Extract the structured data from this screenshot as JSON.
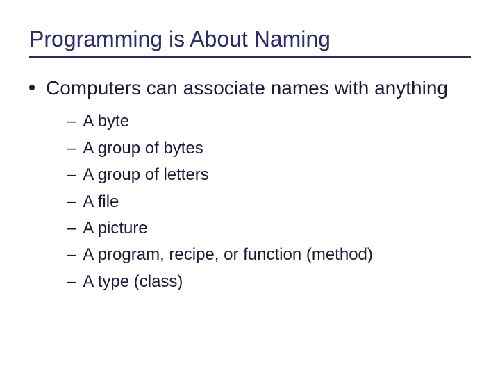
{
  "title": "Programming is About Naming",
  "bullet": {
    "text": "Computers can associate names with anything",
    "subitems": [
      "A byte",
      "A group of bytes",
      "A group of letters",
      "A file",
      "A picture",
      "A program, recipe, or function (method)",
      "A type (class)"
    ]
  }
}
